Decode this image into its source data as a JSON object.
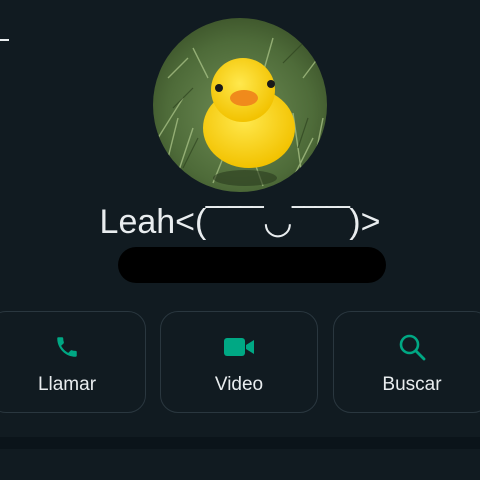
{
  "contact": {
    "name": "Leah<(‾‾‾‾‾◡‾‾‾‾‾)>",
    "avatar": "duck-photo"
  },
  "actions": [
    {
      "label": "Llamar",
      "icon": "phone-icon"
    },
    {
      "label": "Video",
      "icon": "video-camera-icon"
    },
    {
      "label": "Buscar",
      "icon": "search-icon"
    }
  ],
  "colors": {
    "background": "#111b21",
    "accent": "#00a884",
    "text": "#e9edef",
    "card_border": "#2a373f"
  }
}
